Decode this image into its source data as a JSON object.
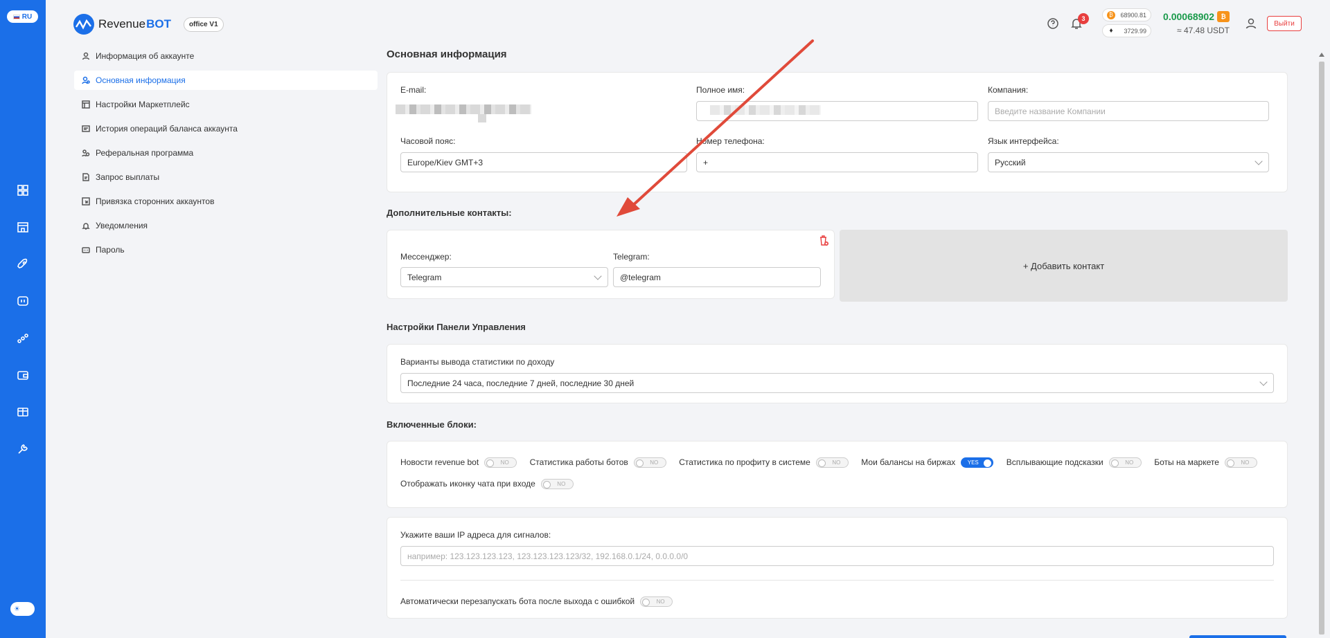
{
  "rail": {
    "lang": "RU",
    "icons": [
      "dashboard-icon",
      "store-icon",
      "rocket-icon",
      "terminal-icon",
      "chart-icon",
      "wallet-icon",
      "gift-icon",
      "wrench-icon"
    ]
  },
  "header": {
    "logo_text": "Revenue",
    "logo_bold": "BOT",
    "office": "office V1",
    "notif_count": "3",
    "btc_price": "68900.81",
    "eth_price": "3729.99",
    "balance": "0.00068902",
    "balance_usdt": "≈ 47.48 USDT",
    "logout": "Выйти"
  },
  "menu": [
    {
      "label": "Информация об аккаунте",
      "active": false
    },
    {
      "label": "Основная информация",
      "active": true
    },
    {
      "label": "Настройки Маркетплейс",
      "active": false
    },
    {
      "label": "История операций баланса аккаунта",
      "active": false
    },
    {
      "label": "Реферальная программа",
      "active": false
    },
    {
      "label": "Запрос выплаты",
      "active": false
    },
    {
      "label": "Привязка сторонних аккаунтов",
      "active": false
    },
    {
      "label": "Уведомления",
      "active": false
    },
    {
      "label": "Пароль",
      "active": false
    }
  ],
  "main": {
    "title": "Основная информация",
    "email_label": "E-mail:",
    "fullname_label": "Полное имя:",
    "company_label": "Компания:",
    "company_placeholder": "Введите название Компании",
    "tz_label": "Часовой пояс:",
    "tz_value": "Europe/Kiev GMT+3",
    "phone_label": "Номер телефона:",
    "phone_value": "+",
    "lang_label": "Язык интерфейса:",
    "lang_value": "Русский"
  },
  "contacts": {
    "title": "Дополнительные контакты:",
    "messenger_label": "Мессенджер:",
    "messenger_value": "Telegram",
    "telegram_label": "Telegram:",
    "telegram_value": "@telegram",
    "add_contact": "+ Добавить контакт"
  },
  "panel": {
    "title": "Настройки Панели Управления",
    "stats_label": "Варианты вывода статистики по доходу",
    "stats_value": "Последние 24 часа, последние 7 дней, последние 30 дней"
  },
  "blocks": {
    "title": "Включенные блоки:",
    "items": [
      {
        "label": "Новости revenue bot",
        "state": "NO"
      },
      {
        "label": "Статистика работы ботов",
        "state": "NO"
      },
      {
        "label": "Статистика по профиту в системе",
        "state": "NO"
      },
      {
        "label": "Мои балансы на биржах",
        "state": "YES"
      },
      {
        "label": "Всплывающие подсказки",
        "state": "NO"
      },
      {
        "label": "Боты на маркете",
        "state": "NO"
      },
      {
        "label": "Отображать иконку чата при входе",
        "state": "NO"
      }
    ]
  },
  "ip": {
    "label": "Укажите ваши IP адреса для сигналов:",
    "placeholder": "например: 123.123.123.123, 123.123.123.123/32, 192.168.0.1/24, 0.0.0.0/0",
    "restart_label": "Автоматически перезапускать бота после выхода с ошибкой",
    "restart_state": "NO"
  },
  "colors": {
    "accent": "#1b6fe8",
    "danger": "#e83e3e",
    "balance": "#1a9a4b",
    "annotation_arrow": "#e04a3a"
  }
}
